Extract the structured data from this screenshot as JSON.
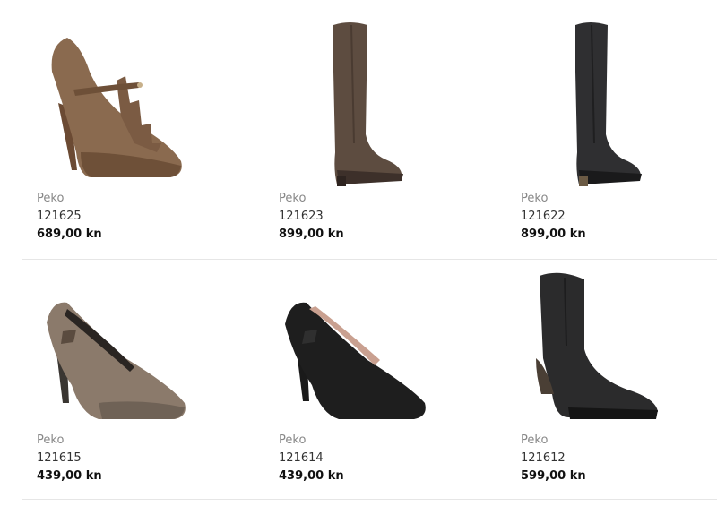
{
  "products": [
    {
      "brand": "Peko",
      "sku": "121625",
      "price": "689,00 kn",
      "image": "brown-suede-ruffle-pump-image"
    },
    {
      "brand": "Peko",
      "sku": "121623",
      "price": "899,00 kn",
      "image": "brown-knee-high-boot-image"
    },
    {
      "brand": "Peko",
      "sku": "121622",
      "price": "899,00 kn",
      "image": "black-knee-high-boot-image"
    },
    {
      "brand": "Peko",
      "sku": "121615",
      "price": "439,00 kn",
      "image": "taupe-patent-pump-image"
    },
    {
      "brand": "Peko",
      "sku": "121614",
      "price": "439,00 kn",
      "image": "black-leather-pump-image"
    },
    {
      "brand": "Peko",
      "sku": "121612",
      "price": "599,00 kn",
      "image": "black-ankle-boot-image"
    }
  ]
}
